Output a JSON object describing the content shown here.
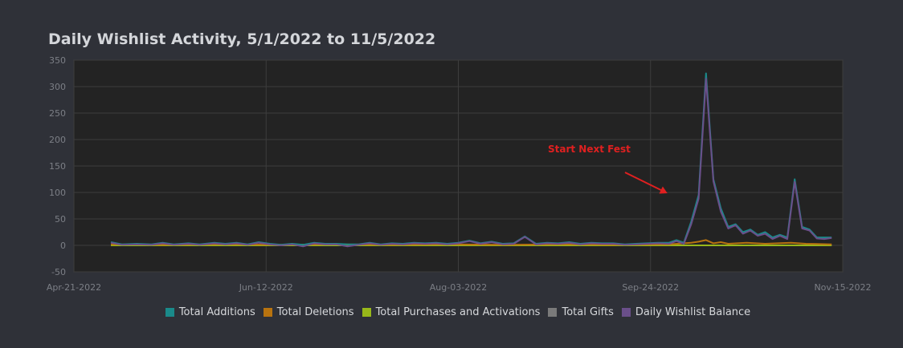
{
  "chart_data": {
    "type": "line",
    "title": "Daily Wishlist Activity, 5/1/2022 to 11/5/2022",
    "xlabel": "",
    "ylabel": "",
    "x_axis": {
      "type": "date",
      "range": [
        "2022-04-21",
        "2022-11-15"
      ],
      "ticks": [
        "Apr-21-2022",
        "Jun-12-2022",
        "Aug-03-2022",
        "Sep-24-2022",
        "Nov-15-2022"
      ],
      "tick_dates": [
        "2022-04-21",
        "2022-06-12",
        "2022-08-03",
        "2022-09-24",
        "2022-11-15"
      ]
    },
    "y_axis": {
      "range": [
        -50,
        350
      ],
      "ticks": [
        -50,
        0,
        50,
        100,
        150,
        200,
        250,
        300,
        350
      ]
    },
    "grid": true,
    "legend_position": "bottom",
    "annotation": {
      "text": "Start Next Fest",
      "color": "#e02020",
      "arrow_target": {
        "x": "2022-09-29",
        "y": 100
      }
    },
    "series": [
      {
        "name": "Total Additions",
        "color": "#1a8a8a",
        "points": [
          [
            "2022-05-01",
            6
          ],
          [
            "2022-05-04",
            2
          ],
          [
            "2022-05-08",
            3
          ],
          [
            "2022-05-12",
            2
          ],
          [
            "2022-05-15",
            5
          ],
          [
            "2022-05-18",
            2
          ],
          [
            "2022-05-22",
            4
          ],
          [
            "2022-05-25",
            2
          ],
          [
            "2022-05-29",
            5
          ],
          [
            "2022-06-01",
            3
          ],
          [
            "2022-06-04",
            5
          ],
          [
            "2022-06-07",
            2
          ],
          [
            "2022-06-10",
            6
          ],
          [
            "2022-06-13",
            3
          ],
          [
            "2022-06-16",
            1
          ],
          [
            "2022-06-19",
            3
          ],
          [
            "2022-06-22",
            1
          ],
          [
            "2022-06-25",
            5
          ],
          [
            "2022-06-28",
            3
          ],
          [
            "2022-07-01",
            3
          ],
          [
            "2022-07-04",
            2
          ],
          [
            "2022-07-07",
            2
          ],
          [
            "2022-07-10",
            5
          ],
          [
            "2022-07-13",
            2
          ],
          [
            "2022-07-16",
            4
          ],
          [
            "2022-07-19",
            3
          ],
          [
            "2022-07-22",
            5
          ],
          [
            "2022-07-25",
            4
          ],
          [
            "2022-07-28",
            5
          ],
          [
            "2022-07-31",
            3
          ],
          [
            "2022-08-03",
            5
          ],
          [
            "2022-08-06",
            9
          ],
          [
            "2022-08-09",
            4
          ],
          [
            "2022-08-12",
            7
          ],
          [
            "2022-08-15",
            3
          ],
          [
            "2022-08-18",
            4
          ],
          [
            "2022-08-21",
            17
          ],
          [
            "2022-08-24",
            3
          ],
          [
            "2022-08-27",
            5
          ],
          [
            "2022-08-30",
            4
          ],
          [
            "2022-09-02",
            6
          ],
          [
            "2022-09-05",
            3
          ],
          [
            "2022-09-08",
            5
          ],
          [
            "2022-09-11",
            4
          ],
          [
            "2022-09-14",
            4
          ],
          [
            "2022-09-17",
            2
          ],
          [
            "2022-09-20",
            3
          ],
          [
            "2022-09-23",
            4
          ],
          [
            "2022-09-26",
            5
          ],
          [
            "2022-09-29",
            5
          ],
          [
            "2022-10-01",
            10
          ],
          [
            "2022-10-03",
            5
          ],
          [
            "2022-10-05",
            45
          ],
          [
            "2022-10-07",
            95
          ],
          [
            "2022-10-09",
            325
          ],
          [
            "2022-10-11",
            125
          ],
          [
            "2022-10-13",
            70
          ],
          [
            "2022-10-15",
            35
          ],
          [
            "2022-10-17",
            40
          ],
          [
            "2022-10-19",
            25
          ],
          [
            "2022-10-21",
            30
          ],
          [
            "2022-10-23",
            20
          ],
          [
            "2022-10-25",
            25
          ],
          [
            "2022-10-27",
            15
          ],
          [
            "2022-10-29",
            20
          ],
          [
            "2022-10-31",
            15
          ],
          [
            "2022-11-02",
            125
          ],
          [
            "2022-11-04",
            35
          ],
          [
            "2022-11-06",
            30
          ],
          [
            "2022-11-08",
            15
          ],
          [
            "2022-11-10",
            15
          ],
          [
            "2022-11-12",
            15
          ]
        ]
      },
      {
        "name": "Total Deletions",
        "color": "#b8730f",
        "points": [
          [
            "2022-05-01",
            2
          ],
          [
            "2022-05-15",
            1
          ],
          [
            "2022-06-01",
            2
          ],
          [
            "2022-06-15",
            1
          ],
          [
            "2022-07-01",
            2
          ],
          [
            "2022-07-15",
            1
          ],
          [
            "2022-08-01",
            2
          ],
          [
            "2022-08-15",
            1
          ],
          [
            "2022-09-01",
            2
          ],
          [
            "2022-09-15",
            1
          ],
          [
            "2022-09-29",
            2
          ],
          [
            "2022-10-05",
            5
          ],
          [
            "2022-10-07",
            7
          ],
          [
            "2022-10-09",
            10
          ],
          [
            "2022-10-11",
            4
          ],
          [
            "2022-10-13",
            6
          ],
          [
            "2022-10-15",
            3
          ],
          [
            "2022-10-20",
            5
          ],
          [
            "2022-10-25",
            3
          ],
          [
            "2022-11-01",
            5
          ],
          [
            "2022-11-05",
            3
          ],
          [
            "2022-11-12",
            2
          ]
        ]
      },
      {
        "name": "Total Purchases and Activations",
        "color": "#98b81a",
        "points": [
          [
            "2022-05-01",
            0
          ],
          [
            "2022-11-12",
            0
          ]
        ]
      },
      {
        "name": "Total Gifts",
        "color": "#7a7a7a",
        "points": [
          [
            "2022-05-01",
            0
          ],
          [
            "2022-11-12",
            0
          ]
        ]
      },
      {
        "name": "Daily Wishlist Balance",
        "color": "#6a4f8a",
        "points": [
          [
            "2022-05-01",
            5
          ],
          [
            "2022-05-04",
            1
          ],
          [
            "2022-05-08",
            2
          ],
          [
            "2022-05-12",
            1
          ],
          [
            "2022-05-15",
            4
          ],
          [
            "2022-05-18",
            1
          ],
          [
            "2022-05-22",
            3
          ],
          [
            "2022-05-25",
            1
          ],
          [
            "2022-05-29",
            4
          ],
          [
            "2022-06-01",
            2
          ],
          [
            "2022-06-04",
            4
          ],
          [
            "2022-06-07",
            1
          ],
          [
            "2022-06-10",
            5
          ],
          [
            "2022-06-13",
            2
          ],
          [
            "2022-06-16",
            0
          ],
          [
            "2022-06-19",
            2
          ],
          [
            "2022-06-22",
            -2
          ],
          [
            "2022-06-25",
            4
          ],
          [
            "2022-06-28",
            2
          ],
          [
            "2022-07-01",
            2
          ],
          [
            "2022-07-04",
            -2
          ],
          [
            "2022-07-07",
            1
          ],
          [
            "2022-07-10",
            4
          ],
          [
            "2022-07-13",
            1
          ],
          [
            "2022-07-16",
            3
          ],
          [
            "2022-07-19",
            2
          ],
          [
            "2022-07-22",
            4
          ],
          [
            "2022-07-25",
            3
          ],
          [
            "2022-07-28",
            4
          ],
          [
            "2022-07-31",
            2
          ],
          [
            "2022-08-03",
            4
          ],
          [
            "2022-08-06",
            8
          ],
          [
            "2022-08-09",
            3
          ],
          [
            "2022-08-12",
            6
          ],
          [
            "2022-08-15",
            2
          ],
          [
            "2022-08-18",
            3
          ],
          [
            "2022-08-21",
            16
          ],
          [
            "2022-08-24",
            2
          ],
          [
            "2022-08-27",
            4
          ],
          [
            "2022-08-30",
            3
          ],
          [
            "2022-09-02",
            5
          ],
          [
            "2022-09-05",
            2
          ],
          [
            "2022-09-08",
            4
          ],
          [
            "2022-09-11",
            3
          ],
          [
            "2022-09-14",
            3
          ],
          [
            "2022-09-17",
            1
          ],
          [
            "2022-09-20",
            2
          ],
          [
            "2022-09-23",
            3
          ],
          [
            "2022-09-26",
            4
          ],
          [
            "2022-09-29",
            3
          ],
          [
            "2022-10-01",
            8
          ],
          [
            "2022-10-03",
            3
          ],
          [
            "2022-10-05",
            40
          ],
          [
            "2022-10-07",
            88
          ],
          [
            "2022-10-09",
            315
          ],
          [
            "2022-10-11",
            121
          ],
          [
            "2022-10-13",
            64
          ],
          [
            "2022-10-15",
            32
          ],
          [
            "2022-10-17",
            38
          ],
          [
            "2022-10-19",
            22
          ],
          [
            "2022-10-21",
            28
          ],
          [
            "2022-10-23",
            18
          ],
          [
            "2022-10-25",
            22
          ],
          [
            "2022-10-27",
            12
          ],
          [
            "2022-10-29",
            18
          ],
          [
            "2022-10-31",
            12
          ],
          [
            "2022-11-02",
            120
          ],
          [
            "2022-11-04",
            32
          ],
          [
            "2022-11-06",
            28
          ],
          [
            "2022-11-08",
            13
          ],
          [
            "2022-11-10",
            12
          ],
          [
            "2022-11-12",
            14
          ]
        ]
      }
    ]
  }
}
